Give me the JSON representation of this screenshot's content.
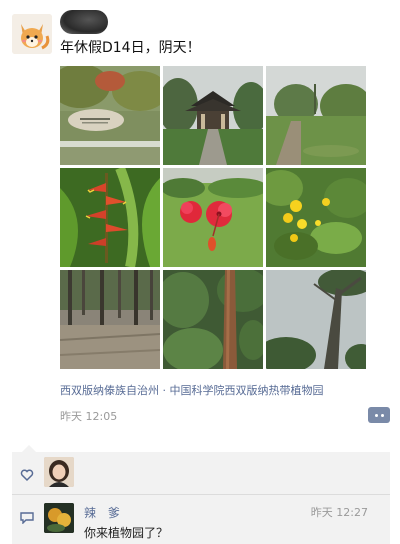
{
  "post": {
    "text": "年休假D14日，阴天！",
    "location": "西双版纳傣族自治州 · 中国科学院西双版纳热带植物园",
    "time": "昨天 12:05"
  },
  "photos": [
    {
      "name": "garden-entrance-sign-photo"
    },
    {
      "name": "pavilion-photo"
    },
    {
      "name": "garden-path-photo"
    },
    {
      "name": "heliconia-flower-photo"
    },
    {
      "name": "red-hibiscus-photo"
    },
    {
      "name": "yellow-flowers-photo"
    },
    {
      "name": "forest-floor-photo"
    },
    {
      "name": "tall-tree-trunk-photo"
    },
    {
      "name": "leaning-tree-photo"
    }
  ],
  "comment": {
    "author": "辣 爹",
    "text": "你来植物园了？",
    "time": "昨天 12:27"
  },
  "colors": {
    "link": "#576b95",
    "meta": "#9a9a9a",
    "panel": "#f2f2f2"
  }
}
